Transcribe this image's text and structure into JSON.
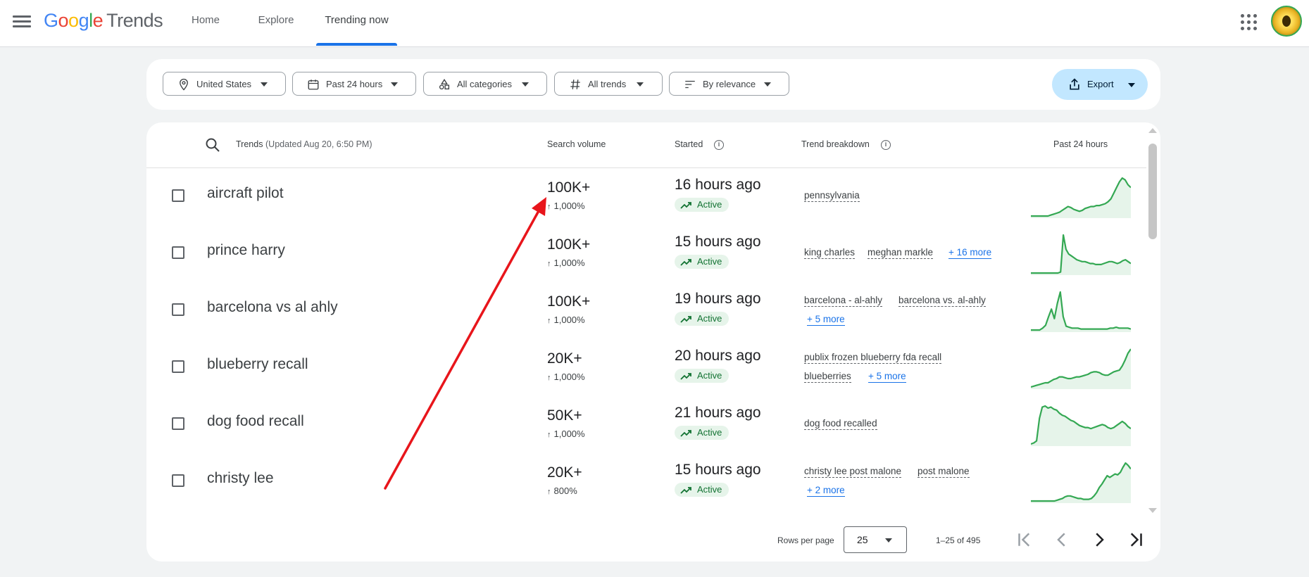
{
  "header": {
    "logo_google": [
      "G",
      "o",
      "o",
      "g",
      "l",
      "e"
    ],
    "logo_trends": "Trends",
    "nav": [
      {
        "label": "Home"
      },
      {
        "label": "Explore"
      },
      {
        "label": "Trending now",
        "active": true
      }
    ]
  },
  "filters": {
    "location": "United States",
    "time": "Past 24 hours",
    "category": "All categories",
    "trend_type": "All trends",
    "sort": "By relevance",
    "export": "Export"
  },
  "table": {
    "headers": {
      "trends": "Trends",
      "updated": "(Updated Aug 20, 6:50 PM)",
      "search_volume": "Search volume",
      "started": "Started",
      "breakdown": "Trend breakdown",
      "past": "Past 24 hours"
    },
    "rows": [
      {
        "term": "aircraft pilot",
        "volume": "100K+",
        "pct": "1,000%",
        "started": "16 hours ago",
        "status": "Active",
        "breakdown": [
          "pennsylvania"
        ],
        "more": "",
        "spark": [
          0,
          0,
          0,
          0,
          0,
          0,
          0,
          1,
          2,
          3,
          4,
          6,
          8,
          10,
          9,
          7,
          6,
          5,
          6,
          8,
          9,
          10,
          10,
          11,
          11,
          12,
          13,
          15,
          18,
          24,
          30,
          36,
          40,
          38,
          33,
          30
        ]
      },
      {
        "term": "prince harry",
        "volume": "100K+",
        "pct": "1,000%",
        "started": "15 hours ago",
        "status": "Active",
        "breakdown": [
          "king charles",
          "meghan markle"
        ],
        "more": "+ 16 more",
        "spark": [
          0,
          0,
          0,
          0,
          0,
          0,
          0,
          0,
          0,
          0,
          0,
          1,
          40,
          25,
          20,
          18,
          16,
          14,
          13,
          12,
          12,
          11,
          10,
          10,
          9,
          9,
          9,
          10,
          11,
          12,
          12,
          11,
          10,
          11,
          13,
          14,
          12,
          10
        ]
      },
      {
        "term": "barcelona vs al ahly",
        "volume": "100K+",
        "pct": "1,000%",
        "started": "19 hours ago",
        "status": "Active",
        "breakdown": [
          "barcelona - al-ahly",
          "barcelona vs. al-ahly"
        ],
        "more": "+ 5 more",
        "spark": [
          0,
          0,
          0,
          0,
          2,
          5,
          14,
          22,
          12,
          28,
          40,
          14,
          4,
          3,
          2,
          2,
          2,
          1,
          1,
          1,
          1,
          1,
          1,
          1,
          1,
          1,
          1,
          2,
          2,
          3,
          2,
          2,
          2,
          2,
          1
        ]
      },
      {
        "term": "blueberry recall",
        "volume": "20K+",
        "pct": "1,000%",
        "started": "20 hours ago",
        "status": "Active",
        "breakdown": [
          "publix frozen blueberry fda recall",
          "blueberries"
        ],
        "more": "+ 5 more",
        "spark": [
          0,
          1,
          2,
          3,
          4,
          5,
          5,
          7,
          9,
          10,
          12,
          12,
          11,
          10,
          10,
          11,
          12,
          12,
          13,
          14,
          15,
          17,
          18,
          18,
          17,
          15,
          14,
          14,
          16,
          18,
          19,
          20,
          25,
          32,
          40,
          45
        ]
      },
      {
        "term": "dog food recall",
        "volume": "50K+",
        "pct": "1,000%",
        "started": "21 hours ago",
        "status": "Active",
        "breakdown": [
          "dog food recalled"
        ],
        "more": "",
        "spark": [
          0,
          1,
          3,
          25,
          36,
          37,
          35,
          36,
          34,
          33,
          30,
          28,
          27,
          25,
          23,
          22,
          20,
          18,
          17,
          16,
          16,
          15,
          16,
          17,
          18,
          19,
          18,
          16,
          15,
          16,
          18,
          20,
          22,
          20,
          17,
          15
        ]
      },
      {
        "term": "christy lee",
        "volume": "20K+",
        "pct": "800%",
        "started": "15 hours ago",
        "status": "Active",
        "breakdown": [
          "christy lee post malone",
          "post malone"
        ],
        "more": "+ 2 more",
        "spark": [
          0,
          0,
          0,
          0,
          0,
          0,
          0,
          0,
          0,
          0,
          1,
          2,
          3,
          5,
          6,
          6,
          5,
          4,
          3,
          3,
          2,
          2,
          2,
          3,
          6,
          10,
          16,
          20,
          25,
          30,
          28,
          30,
          32,
          31,
          34,
          40,
          45,
          42,
          38
        ]
      }
    ]
  },
  "pagination": {
    "rows_per_page_label": "Rows per page",
    "rows_per_page": "25",
    "range": "1–25 of 495"
  },
  "colors": {
    "accent": "#1a73e8",
    "spark_line": "#34a853",
    "active_bg": "#e6f4ea",
    "active_text": "#137333",
    "export_bg": "#c2e7ff",
    "annotation_arrow": "#e8151b"
  }
}
